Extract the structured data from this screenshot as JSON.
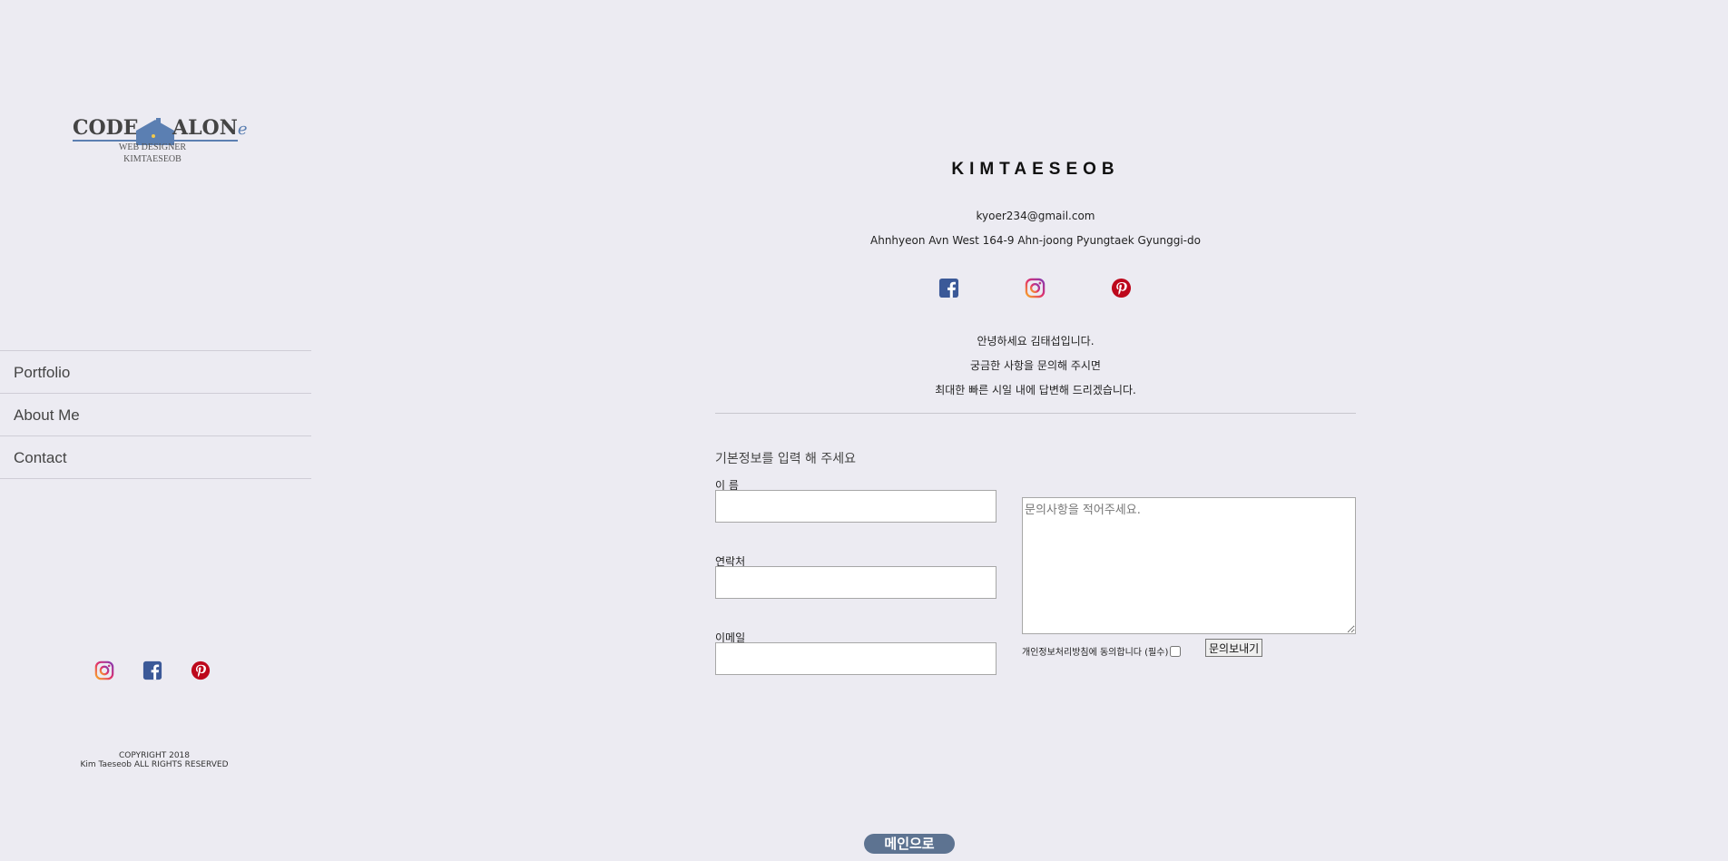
{
  "logo": {
    "word_left": "CODE",
    "word_right": "ALON",
    "word_tail": "e",
    "line1": "WEB DESIGNER",
    "line2": "KIMTAESEOB"
  },
  "nav": {
    "items": [
      {
        "label": "Portfolio"
      },
      {
        "label": "About Me"
      },
      {
        "label": "Contact"
      }
    ]
  },
  "sidebar_social": [
    "instagram-icon",
    "facebook-icon",
    "pinterest-icon"
  ],
  "copyright": {
    "line1": "COPYRIGHT 2018",
    "line2": "Kim Taeseob ALL RIGHTS RESERVED"
  },
  "profile": {
    "name": "KIMTAESEOB",
    "email": "kyoer234@gmail.com",
    "address": "Ahnhyeon Avn West 164-9 Ahn-joong Pyungtaek Gyunggi-do",
    "social": [
      "facebook-icon",
      "instagram-icon",
      "pinterest-icon"
    ],
    "intro": [
      "안녕하세요 김태섭입니다.",
      "궁금한 사항을 문의해 주시면",
      "최대한 빠른 시일 내에 답변해 드리겠습니다."
    ]
  },
  "form": {
    "heading": "기본정보를 입력 해 주세요",
    "name_label": "이 름",
    "name_value": "",
    "phone_label": "연락처",
    "phone_value": "",
    "email_label": "이메일",
    "email_value": "",
    "message_placeholder": "문의사항을 적어주세요.",
    "agree_label": "개인정보처리방침에 동의합니다 (필수)",
    "agree_checked": false,
    "submit_label": "문의보내기"
  },
  "home_button": "메인으로",
  "colors": {
    "background": "#ecebf2",
    "accent": "#5b7fb2",
    "home_button": "#5d7391",
    "facebook": "#3b5998",
    "pinterest": "#bd081c"
  }
}
